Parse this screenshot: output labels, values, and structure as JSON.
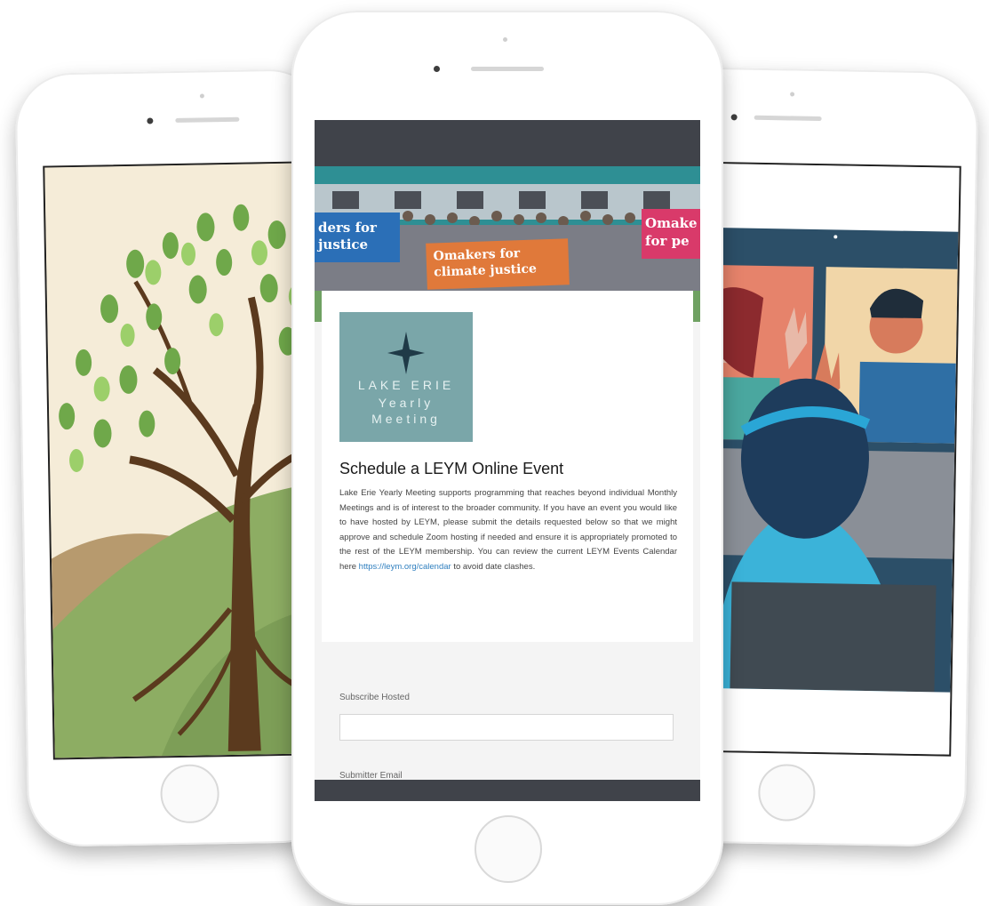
{
  "center_phone": {
    "hero": {
      "banners": [
        "ders for justice",
        "Omakers for climate justice",
        "Omake for pe"
      ]
    },
    "logo": {
      "line1": "LAKE ERIE",
      "line2": "Yearly",
      "line3": "Meeting"
    },
    "form": {
      "title": "Schedule a LEYM Online Event",
      "description": "Lake Erie Yearly Meeting supports programming that reaches beyond individual Monthly Meetings and is of interest to the broader community. If you have an event you would like to have hosted by LEYM, please submit the details requested below so that we might approve and schedule Zoom hosting if needed and ensure it is appropriately promoted to the rest of the LEYM membership. You can review the current LEYM Events Calendar here",
      "link_text": "https://leym.org/calendar",
      "description_end": "to avoid date clashes.",
      "field1_label": "Subscribe Hosted",
      "field2_label": "Submitter Email"
    }
  },
  "colors": {
    "screen_bar": "#40434a",
    "hero_teal": "#2e8f94",
    "logo_teal": "#7aa6a9",
    "link": "#2f7fbf"
  }
}
